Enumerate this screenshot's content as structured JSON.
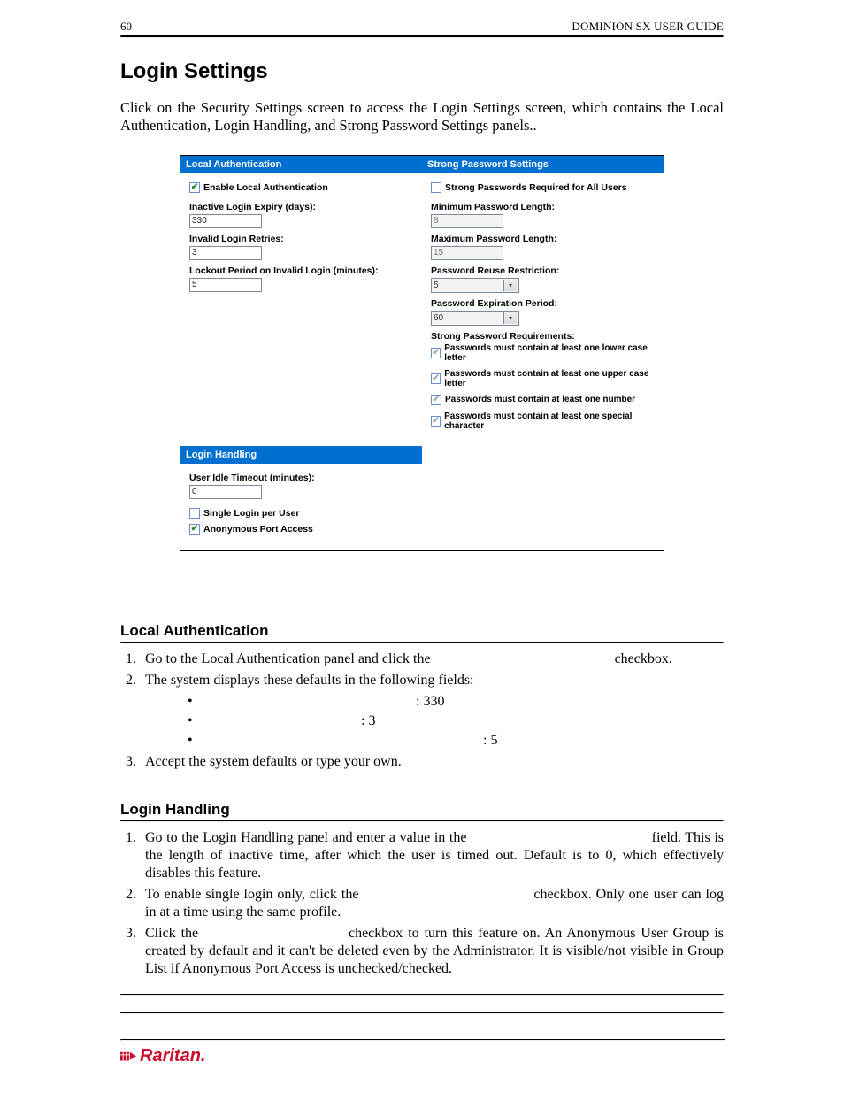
{
  "header": {
    "page_num": "60",
    "guide": "DOMINION SX USER GUIDE"
  },
  "h1": "Login Settings",
  "intro": "Click                              on the Security Settings screen to access the Login Settings screen, which contains the Local Authentication, Login Handling, and Strong Password Settings panels..",
  "shot": {
    "local_auth": {
      "title": "Local Authentication",
      "enable": "Enable Local Authentication",
      "inactive_label": "Inactive Login Expiry (days):",
      "inactive_val": "330",
      "retries_label": "Invalid Login Retries:",
      "retries_val": "3",
      "lockout_label": "Lockout Period on Invalid Login (minutes):",
      "lockout_val": "5"
    },
    "strong": {
      "title": "Strong Password Settings",
      "req_all": "Strong Passwords Required for All Users",
      "min_label": "Minimum Password Length:",
      "min_val": "8",
      "max_label": "Maximum Password Length:",
      "max_val": "15",
      "reuse_label": "Password Reuse Restriction:",
      "reuse_val": "5",
      "expire_label": "Password Expiration Period:",
      "expire_val": "60",
      "req_header": "Strong Password Requirements:",
      "r1": "Passwords must contain at least one lower case letter",
      "r2": "Passwords must contain at least one upper case letter",
      "r3": "Passwords must contain at least one number",
      "r4": "Passwords must contain at least one special character"
    },
    "login_handling": {
      "title": "Login Handling",
      "idle_label": "User Idle Timeout (minutes):",
      "idle_val": "0",
      "single": "Single Login per User",
      "anon": "Anonymous Port Access"
    }
  },
  "sec1": {
    "title": "Local Authentication",
    "li1_a": "Go to the Local Authentication panel and click the ",
    "li1_b": " checkbox.",
    "li2": "The system displays these defaults in the following fields:",
    "b1_val": ":  330",
    "b2_val": ":  3",
    "b3_val": ":  5",
    "li3": "Accept the system defaults or type your own."
  },
  "sec2": {
    "title": "Login Handling",
    "li1_a": "Go to the Login Handling panel and enter a value in the ",
    "li1_b": " field. This is the length of inactive time, after which the user is timed out. Default is to 0, which effectively disables this feature.",
    "li2_a": "To enable single login only, click the ",
    "li2_b": " checkbox. Only one user can log in at a time using the same profile.",
    "li3_a": "Click the ",
    "li3_b": " checkbox to turn this feature on. An Anonymous User Group is created by default and it can't be deleted even by the Administrator. It is visible/not visible in Group List if Anonymous Port Access is unchecked/checked."
  },
  "footer_brand": "Raritan."
}
